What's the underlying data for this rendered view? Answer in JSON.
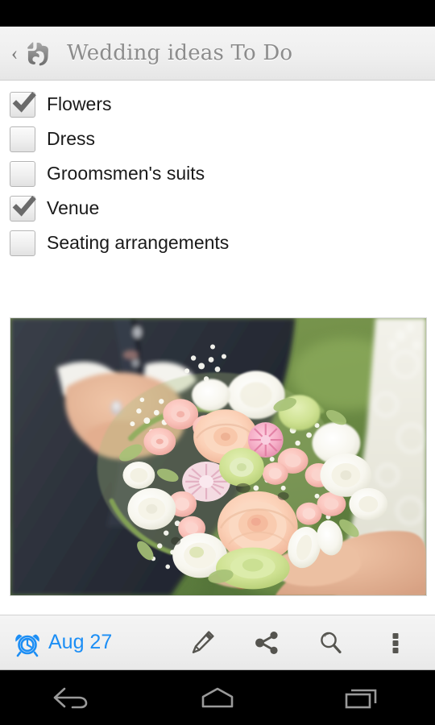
{
  "status_bar": {
    "icons": []
  },
  "header": {
    "back_label": "‹",
    "logo_icon": "evernote-elephant-icon",
    "title": "Wedding ideas To Do"
  },
  "note": {
    "todo_items": [
      {
        "label": "Flowers",
        "checked": true
      },
      {
        "label": "Dress",
        "checked": false
      },
      {
        "label": "Groomsmen's suits",
        "checked": false
      },
      {
        "label": "Venue",
        "checked": true
      },
      {
        "label": "Seating arrangements",
        "checked": false
      }
    ],
    "attachment": {
      "name": "wedding-bouquet-photo",
      "alt": "Bride and groom holding a pink and white rose bouquet"
    }
  },
  "toolbar": {
    "reminder": {
      "icon": "alarm-clock-icon",
      "date": "Aug 27",
      "color": "#1c8ef5"
    },
    "actions": [
      {
        "name": "edit-button",
        "icon": "pencil-icon"
      },
      {
        "name": "share-button",
        "icon": "share-icon"
      },
      {
        "name": "search-button",
        "icon": "search-icon"
      },
      {
        "name": "overflow-button",
        "icon": "overflow-menu-icon"
      }
    ]
  },
  "nav_bar": {
    "buttons": [
      {
        "name": "back-button",
        "icon": "back-arrow-icon"
      },
      {
        "name": "home-button",
        "icon": "home-icon"
      },
      {
        "name": "recents-button",
        "icon": "recents-icon"
      }
    ]
  },
  "colors": {
    "accent": "#1c8ef5",
    "header_bg": "#efefef",
    "toolbar_icon": "#55544f",
    "text": "#1a1a1a",
    "title_text": "#8c8c8c"
  }
}
